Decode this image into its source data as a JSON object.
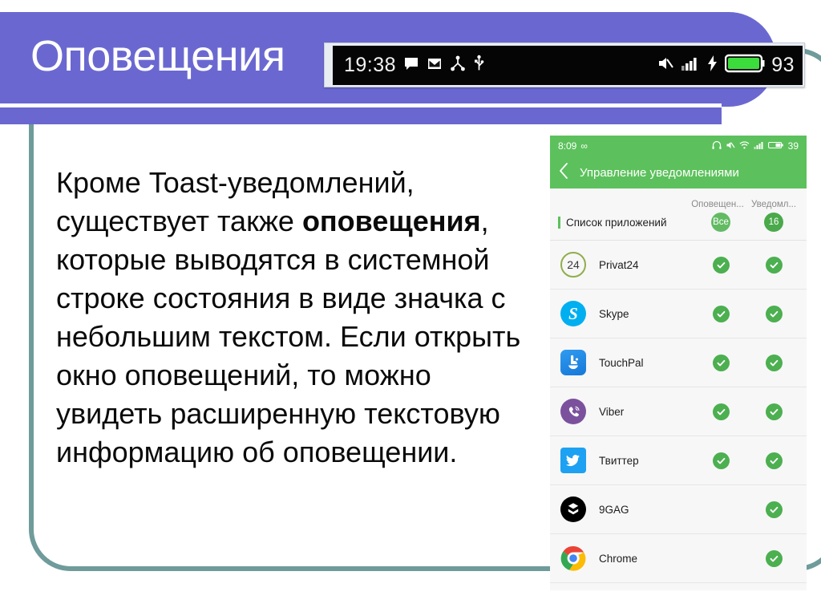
{
  "slide": {
    "title": "Оповещения",
    "body_before_bold": "Кроме Toast-уведомлений, существует также ",
    "body_bold": "оповещения",
    "body_after_bold": ", которые выводятся в системной строке состояния в виде значка с небольшим текстом. Если открыть окно оповещений, то можно увидеть расширенную текстовую информацию об оповещении.",
    "accent_purple": "#6a68d0",
    "accent_teal": "#6f9b9b"
  },
  "statusbar_shot": {
    "clock": "19:38",
    "battery_percent": "93",
    "left_icons": [
      "message-icon",
      "gmail-icon",
      "share-icon",
      "usb-icon"
    ],
    "right_icons": [
      "mute-icon",
      "signal-icon",
      "charging-bolt-icon",
      "battery-icon"
    ],
    "battery_color": "#3ddc3d"
  },
  "phone": {
    "status": {
      "time": "8:09",
      "infinity": "∞",
      "battery_percent": "39",
      "icons": [
        "headphone-icon",
        "mute-icon",
        "wifi-icon",
        "signal-icon",
        "battery-icon"
      ]
    },
    "appbar": {
      "back_icon": "back-chevron-icon",
      "title": "Управление уведомлениями",
      "bg": "#5cc15c"
    },
    "columns": [
      "Оповещен...",
      "Уведомл..."
    ],
    "list_header": {
      "label": "Список приложений",
      "badge_all": "Все",
      "badge_count": "16"
    },
    "apps": [
      {
        "name": "Privat24",
        "icon": "privat24-icon",
        "icon_label": "24",
        "alerts": true,
        "notifications": true
      },
      {
        "name": "Skype",
        "icon": "skype-icon",
        "icon_label": "S",
        "alerts": true,
        "notifications": true
      },
      {
        "name": "TouchPal",
        "icon": "touchpal-icon",
        "icon_label": "",
        "alerts": true,
        "notifications": true
      },
      {
        "name": "Viber",
        "icon": "viber-icon",
        "icon_label": "",
        "alerts": true,
        "notifications": true
      },
      {
        "name": "Твиттер",
        "icon": "twitter-icon",
        "icon_label": "",
        "alerts": true,
        "notifications": true
      },
      {
        "name": "9GAG",
        "icon": "9gag-icon",
        "icon_label": "",
        "alerts": false,
        "notifications": true
      },
      {
        "name": "Chrome",
        "icon": "chrome-icon",
        "icon_label": "",
        "alerts": false,
        "notifications": true
      }
    ]
  }
}
